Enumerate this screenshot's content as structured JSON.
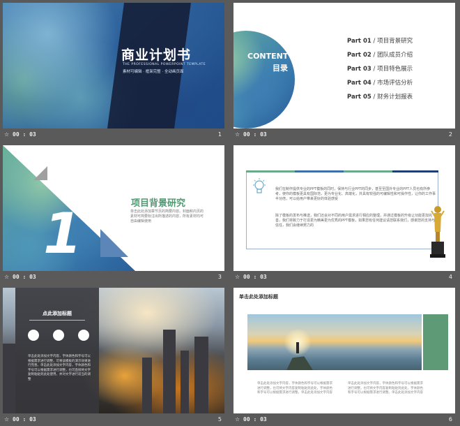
{
  "slides": [
    {
      "number": "1",
      "duration": "00 : 03",
      "title": "商业计划书",
      "subtitle_en": "THE PROFESSIONAL POWERPOINT TEMPLATE",
      "subtitle_cn": "素材可编辑 · 框架完整 · 全动画页面"
    },
    {
      "number": "2",
      "duration": "00 : 03",
      "content_en": "CONTENT",
      "content_cn": "目录",
      "parts": [
        {
          "part": "Part 01",
          "label": "项目背景研究"
        },
        {
          "part": "Part 02",
          "label": "团队成员介绍"
        },
        {
          "part": "Part 03",
          "label": "项目特色展示"
        },
        {
          "part": "Part 04",
          "label": "市场评估分析"
        },
        {
          "part": "Part 05",
          "label": "财务计划报表"
        }
      ]
    },
    {
      "number": "3",
      "duration": "00 : 03",
      "big_number": "1",
      "title": "项目背景研究",
      "desc": "单击此处添加章节页的简要内容。封面和内页的素材可简要标注出所描述的内容，所有素材均可自由编辑使用"
    },
    {
      "number": "4",
      "duration": "00 : 03",
      "para1": "我们在制作提供专业的PPT模板的同时，保持与行业PPT的同步，甚至至国外专业的PPT人员也有所参考，使你的模板更具有国际范，更为专业化、高端化，并具有较强的可编辑性和可操作性，让你的工作事半功倍，可以给用户带来更好的体验感受",
      "para2": "除了模板的发布与推送，我们还会对不同的用户需求进行相应的整理，并通过模板的升级让功能更加完善，我们将致力于打造更为精美更为优秀的PPT模板，如果您有任何建议请您联系我们，感谢您的支持与信任，我们会继续努力的"
    },
    {
      "number": "5",
      "duration": "00 : 03",
      "title": "点此添加标题",
      "text": "单击此处添加文字内容，字体颜色和字号可以根据需求进行调整，可将该模板的演示效果进行完善。单击此处添加文字内容，字体颜色和字号可以根据需求进行调整，也可直接将文字复制粘贴到此处使用，并对文字进行适当的调整"
    },
    {
      "number": "6",
      "duration": "00 : 03",
      "title": "单击此处添加标题",
      "col1": "单击此处添加文字内容，字体颜色和字号可以根据需求进行调整，也可将文字内容复制粘贴到此处，字体颜色和字号可以根据需求进行调整。单击此处添加文字内容",
      "col2": "单击此处添加文字内容，字体颜色和字号可以根据需求进行调整，也可将文字内容复制粘贴到此处，字体颜色和字号可以根据需求进行调整。单击此处添加文字内容"
    }
  ],
  "colors": {
    "accent_green": "#4e9a71",
    "bar_blue": "#3f6fa8",
    "bar_green": "#6aa98a",
    "bar_navy": "#1f3f73"
  },
  "icons": {
    "footer": "star-icon",
    "slide4_bulb": "lightbulb-icon",
    "slide4_trophy": "trophy-icon",
    "slide5": [
      "clock-icon",
      "chart-icon",
      "cloud-icon"
    ]
  }
}
